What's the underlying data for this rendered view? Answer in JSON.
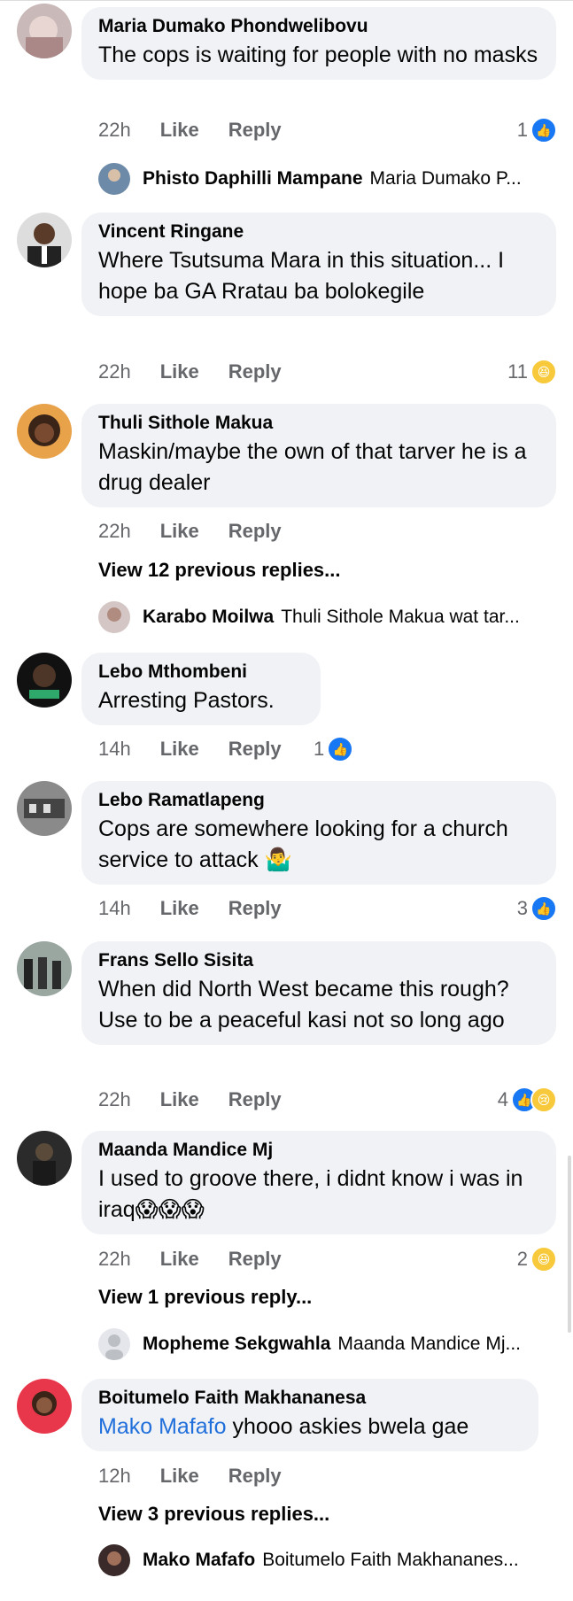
{
  "comments": [
    {
      "author": "Maria Dumako Phondwelibovu",
      "text": "The cops is waiting for people with no masks",
      "time": "22h",
      "like": "Like",
      "reply": "Reply",
      "reaction_count": "1",
      "reply_preview": {
        "author": "Phisto Daphilli Mampane",
        "text": "Maria Dumako P..."
      }
    },
    {
      "author": "Vincent Ringane",
      "text": "Where Tsutsuma Mara in this situation... I hope ba GA Rratau ba bolokegile",
      "time": "22h",
      "like": "Like",
      "reply": "Reply",
      "reaction_count": "11"
    },
    {
      "author": "Thuli Sithole Makua",
      "text": "Maskin/maybe the own of that tarver he is a drug dealer",
      "time": "22h",
      "like": "Like",
      "reply": "Reply",
      "view_more": "View 12 previous replies...",
      "reply_preview": {
        "author": "Karabo Moilwa",
        "text": "Thuli Sithole Makua wat tar..."
      }
    },
    {
      "author": "Lebo Mthombeni",
      "text": "Arresting Pastors.",
      "time": "14h",
      "like": "Like",
      "reply": "Reply",
      "reaction_count": "1"
    },
    {
      "author": "Lebo Ramatlapeng",
      "text": "Cops are somewhere looking for a church service to attack 🤷‍♂️",
      "time": "14h",
      "like": "Like",
      "reply": "Reply",
      "reaction_count": "3"
    },
    {
      "author": "Frans Sello Sisita",
      "text": "When did North West became this rough? Use to be a peaceful kasi not so long ago",
      "time": "22h",
      "like": "Like",
      "reply": "Reply",
      "reaction_count": "4"
    },
    {
      "author": "Maanda Mandice Mj",
      "text": "I used to groove there, i didnt know i was in iraq😱😱😱",
      "time": "22h",
      "like": "Like",
      "reply": "Reply",
      "reaction_count": "2",
      "view_more": "View 1 previous reply...",
      "reply_preview": {
        "author": "Mopheme Sekgwahla",
        "text": "Maanda Mandice Mj..."
      }
    },
    {
      "author": "Boitumelo Faith Makhananesa",
      "mention": "Mako Mafafo",
      "text": " yhooo askies bwela gae",
      "time": "12h",
      "like": "Like",
      "reply": "Reply",
      "view_more": "View 3 previous replies...",
      "reply_preview": {
        "author": "Mako Mafafo",
        "text": "Boitumelo Faith Makhananes..."
      }
    }
  ],
  "colors": {
    "bubble": "#f0f2f5",
    "meta": "#65676b",
    "mention": "#216fdb",
    "like": "#1877f2",
    "haha": "#f7c93b"
  }
}
